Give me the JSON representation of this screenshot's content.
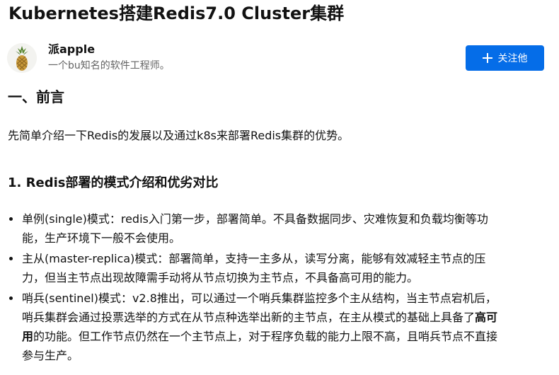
{
  "article": {
    "title": "Kubernetes搭建Redis7.0 Cluster集群"
  },
  "author": {
    "name": "派apple",
    "bio": "一个bu知名的软件工程师。",
    "avatar_icon": "pineapple-icon"
  },
  "follow_button": {
    "label": "关注他",
    "icon": "plus-icon",
    "color": "#056de8"
  },
  "content": {
    "h1": "一、前言",
    "intro": "先简单介绍一下Redis的发展以及通过k8s来部署Redis集群的优势。",
    "h2": "1. Redis部署的模式介绍和优劣对比",
    "items": [
      {
        "lines": [
          "单例(single)模式：redis入门第一步，部署简单。不具备数据同步、灾难恢复和负载均衡等功",
          "能，生产环境下一般不会使用。"
        ]
      },
      {
        "lines": [
          "主从(master-replica)模式：部署简单，支持一主多从，读写分离，能够有效减轻主节点的压",
          "力，但当主节点出现故障需手动将从节点切换为主节点，不具备高可用的能力。"
        ]
      },
      {
        "line1": "哨兵(sentinel)模式：v2.8推出，可以通过一个哨兵集群监控多个主从结构，当主节点宕机后，",
        "line2_plain": "哨兵集群会通过投票选举的方式在从节点种选举出新的主节点，在主从模式的基础上具备了",
        "line2_bold": "高可",
        "line3_bold": "用",
        "line3_plain": "的功能。但工作节点仍然在一个主节点上，对于程序负载的能力上限不高，且哨兵节点不直接",
        "line4": "参与生产。"
      }
    ]
  }
}
